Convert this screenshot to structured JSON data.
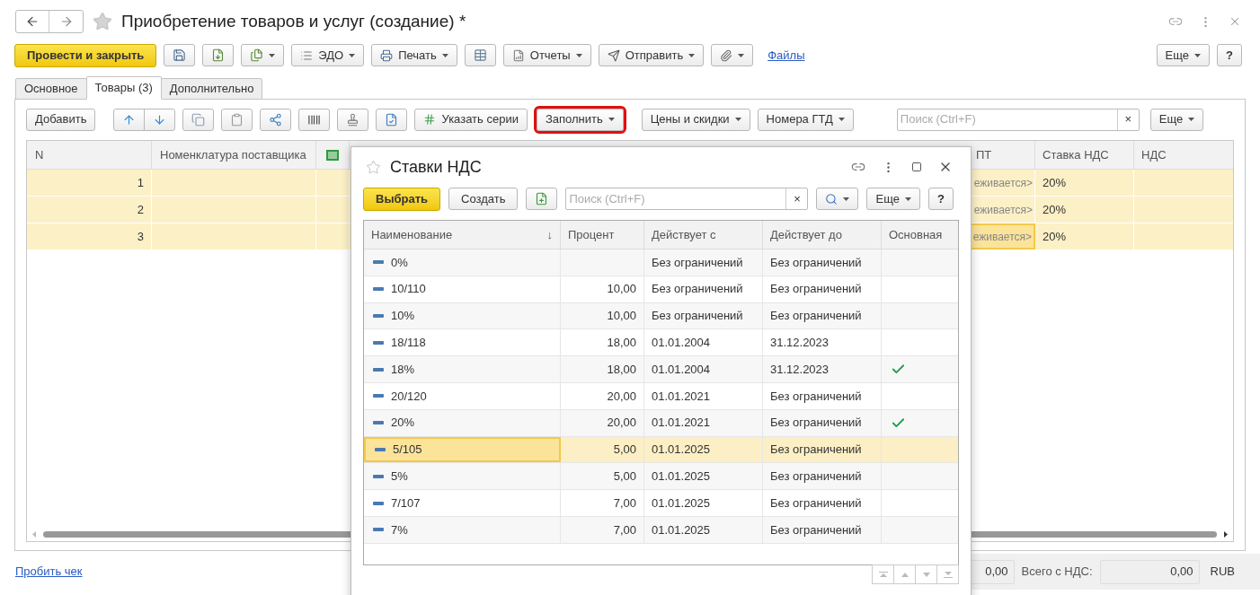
{
  "window": {
    "title": "Приобретение товаров и услуг (создание) *"
  },
  "command_bar": {
    "post_and_close": "Провести и закрыть",
    "edo": "ЭДО",
    "print": "Печать",
    "reports": "Отчеты",
    "send": "Отправить",
    "files": "Файлы",
    "more": "Еще",
    "help": "?"
  },
  "tabs": [
    {
      "label": "Основное",
      "selected": false
    },
    {
      "label": "Товары (3)",
      "selected": true
    },
    {
      "label": "Дополнительно",
      "selected": false
    }
  ],
  "goods_toolbar": {
    "add": "Добавить",
    "series": "Указать серии",
    "fill": {
      "label": "Заполнить",
      "highlighted": true
    },
    "prices": "Цены и скидки",
    "gtd": "Номера ГТД",
    "search_placeholder": "Поиск (Ctrl+F)",
    "clear": "×",
    "more": "Еще"
  },
  "goods_table": {
    "columns": {
      "n": "N",
      "supplier_item": "Номенклатура поставщика",
      "column_5": "ПТ",
      "vat_rate": "Ставка НДС",
      "vat": "НДС"
    },
    "rows": [
      {
        "n": "1",
        "column_5": "еживается>",
        "vat_rate": "20%",
        "selected": true,
        "focused": false
      },
      {
        "n": "2",
        "column_5": "еживается>",
        "vat_rate": "20%",
        "selected": true,
        "focused": false
      },
      {
        "n": "3",
        "column_5": "еживается>",
        "vat_rate": "20%",
        "selected": true,
        "focused": true
      }
    ]
  },
  "footer": {
    "receipt_link": "Пробить чек",
    "vat_total": "0,00",
    "total_label": "Всего с НДС:",
    "total": "0,00",
    "currency": "RUB"
  },
  "dialog": {
    "title": "Ставки НДС",
    "select": "Выбрать",
    "create": "Создать",
    "search_placeholder": "Поиск (Ctrl+F)",
    "clear": "×",
    "more": "Еще",
    "help": "?",
    "columns": {
      "name": "Наименование",
      "sort": "↓",
      "percent": "Процент",
      "from": "Действует с",
      "to": "Действует до",
      "main": "Основная"
    },
    "rows": [
      {
        "name": "0%",
        "percent": "",
        "from": "Без ограничений",
        "to": "Без ограничений",
        "main": false,
        "selected": false
      },
      {
        "name": "10/110",
        "percent": "10,00",
        "from": "Без ограничений",
        "to": "Без ограничений",
        "main": false,
        "selected": false
      },
      {
        "name": "10%",
        "percent": "10,00",
        "from": "Без ограничений",
        "to": "Без ограничений",
        "main": false,
        "selected": false
      },
      {
        "name": "18/118",
        "percent": "18,00",
        "from": "01.01.2004",
        "to": "31.12.2023",
        "main": false,
        "selected": false
      },
      {
        "name": "18%",
        "percent": "18,00",
        "from": "01.01.2004",
        "to": "31.12.2023",
        "main": true,
        "selected": false
      },
      {
        "name": "20/120",
        "percent": "20,00",
        "from": "01.01.2021",
        "to": "Без ограничений",
        "main": false,
        "selected": false
      },
      {
        "name": "20%",
        "percent": "20,00",
        "from": "01.01.2021",
        "to": "Без ограничений",
        "main": true,
        "selected": false
      },
      {
        "name": "5/105",
        "percent": "5,00",
        "from": "01.01.2025",
        "to": "Без ограничений",
        "main": false,
        "selected": true
      },
      {
        "name": "5%",
        "percent": "5,00",
        "from": "01.01.2025",
        "to": "Без ограничений",
        "main": false,
        "selected": false
      },
      {
        "name": "7/107",
        "percent": "7,00",
        "from": "01.01.2025",
        "to": "Без ограничений",
        "main": false,
        "selected": false
      },
      {
        "name": "7%",
        "percent": "7,00",
        "from": "01.01.2025",
        "to": "Без ограничений",
        "main": false,
        "selected": false
      }
    ]
  }
}
